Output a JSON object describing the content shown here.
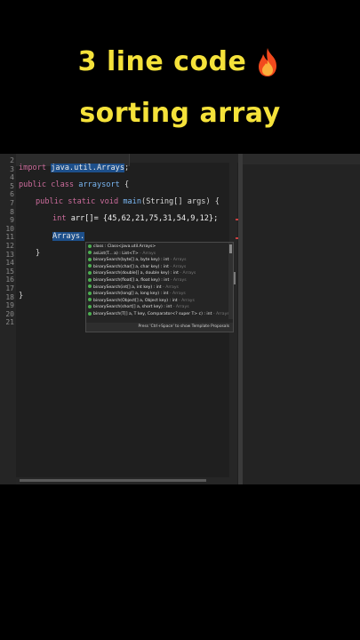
{
  "title": {
    "line1": "3 line code",
    "line2": "sorting array"
  },
  "editor": {
    "line_numbers": [
      "2",
      "3",
      "4",
      "5",
      "6",
      "7",
      "8",
      "9",
      "10",
      "11",
      "12",
      "13",
      "14",
      "15",
      "16",
      "17",
      "18",
      "19",
      "20",
      "21"
    ],
    "code": {
      "import_kw": "import",
      "import_pkg": "java.util.Arrays",
      "import_end": ";",
      "class_decl": "public class ",
      "class_name": "arraysort",
      "class_brace": " {",
      "main_decl": "public static void ",
      "main_name": "main",
      "main_args": "(String[] args) {",
      "array_type": "int",
      "array_decl": " arr[]= {45,62,21,75,31,54,9,12};",
      "arrays_ref": "Arrays.",
      "brace": "}"
    }
  },
  "autocomplete": {
    "items": [
      {
        "label": "class : Class<java.util.Arrays>",
        "src": ""
      },
      {
        "label": "asList(T... a) : List<T>",
        "src": "Arrays"
      },
      {
        "label": "binarySearch(byte[] a, byte key) : int",
        "src": "Arrays"
      },
      {
        "label": "binarySearch(char[] a, char key) : int",
        "src": "Arrays"
      },
      {
        "label": "binarySearch(double[] a, double key) : int",
        "src": "Arrays"
      },
      {
        "label": "binarySearch(float[] a, float key) : int",
        "src": "Arrays"
      },
      {
        "label": "binarySearch(int[] a, int key) : int",
        "src": "Arrays"
      },
      {
        "label": "binarySearch(long[] a, long key) : int",
        "src": "Arrays"
      },
      {
        "label": "binarySearch(Object[] a, Object key) : int",
        "src": "Arrays"
      },
      {
        "label": "binarySearch(short[] a, short key) : int",
        "src": "Arrays"
      },
      {
        "label": "binarySearch(T[] a, T key, Comparator<? super T> c) : int",
        "src": "Arrays"
      }
    ],
    "footer": "Press 'Ctrl+Space' to show Template Proposals"
  },
  "colors": {
    "title": "#f5e23a",
    "editor_bg": "#1f1f1f",
    "keyword": "#cc6c9c",
    "type": "#79b6f2",
    "highlight": "#1d4f8a"
  }
}
